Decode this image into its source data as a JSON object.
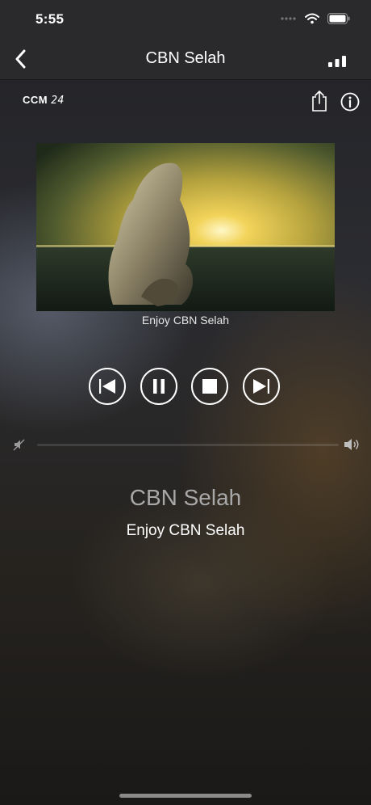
{
  "status_bar": {
    "time": "5:55"
  },
  "nav": {
    "title": "CBN Selah"
  },
  "header": {
    "logo_prefix": "CCM",
    "logo_suffix": "24"
  },
  "now_playing": {
    "artwork_caption": "Enjoy CBN Selah",
    "station": "CBN Selah",
    "subtitle": "Enjoy CBN Selah"
  },
  "volume": {
    "level": 0.0
  },
  "icons": {
    "back": "chevron-left-icon",
    "signal": "signal-bars-icon",
    "share": "share-icon",
    "info": "info-icon",
    "previous": "skip-previous-icon",
    "pause": "pause-icon",
    "stop": "stop-icon",
    "next": "skip-next-icon",
    "mute": "volume-mute-icon",
    "volume": "volume-up-icon"
  }
}
